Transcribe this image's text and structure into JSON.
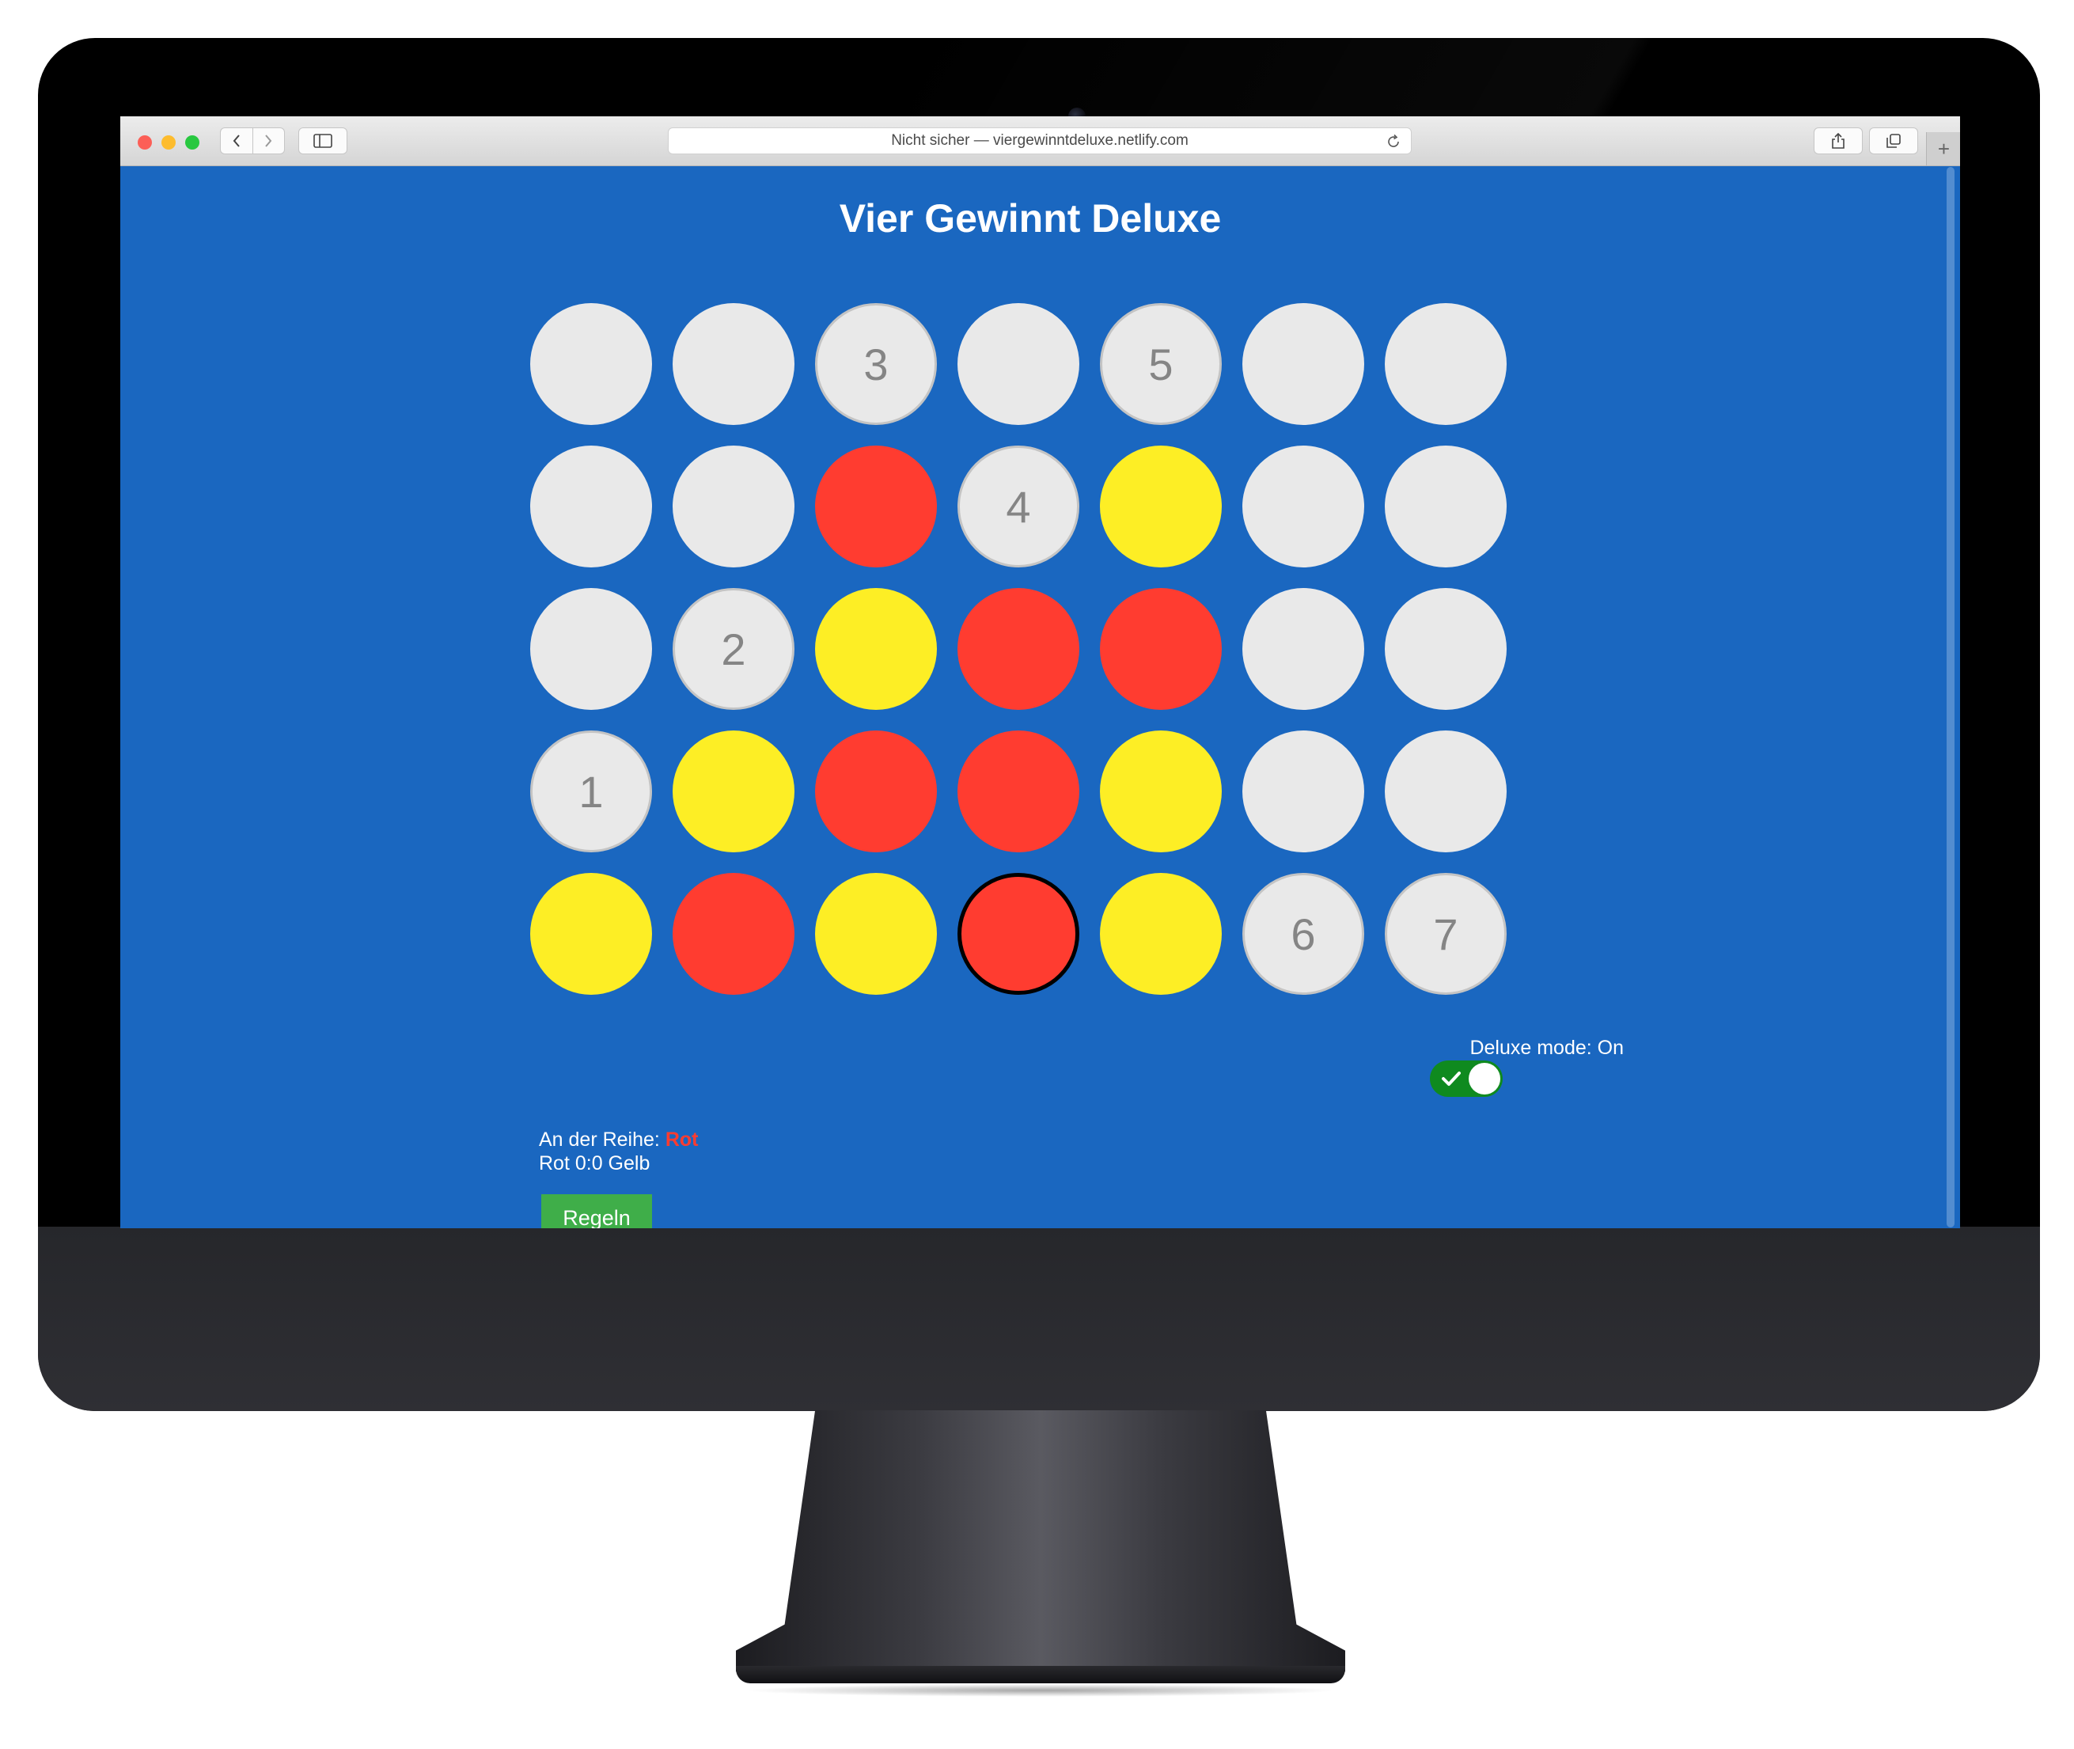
{
  "browser": {
    "address": "Nicht sicher — viergewinntdeluxe.netlify.com"
  },
  "page": {
    "title": "Vier Gewinnt Deluxe"
  },
  "board": {
    "rows": 5,
    "columns": 7,
    "colors": {
      "red": "#ff3c30",
      "yellow": "#fdee25",
      "empty": "#e9e9e9",
      "page_background": "#1a67c0"
    },
    "cells": [
      [
        "empty",
        "empty",
        "hint",
        "empty",
        "hint",
        "empty",
        "empty"
      ],
      [
        "empty",
        "empty",
        "red",
        "hint",
        "yellow",
        "empty",
        "empty"
      ],
      [
        "empty",
        "hint",
        "yellow",
        "red",
        "red",
        "empty",
        "empty"
      ],
      [
        "hint",
        "yellow",
        "red",
        "red",
        "yellow",
        "empty",
        "empty"
      ],
      [
        "yellow",
        "red",
        "yellow",
        "red",
        "yellow",
        "hint",
        "hint"
      ]
    ],
    "hint_labels": [
      [
        "",
        "",
        "3",
        "",
        "5",
        "",
        ""
      ],
      [
        "",
        "",
        "",
        "4",
        "",
        "",
        ""
      ],
      [
        "",
        "2",
        "",
        "",
        "",
        "",
        ""
      ],
      [
        "1",
        "",
        "",
        "",
        "",
        "",
        ""
      ],
      [
        "",
        "",
        "",
        "",
        "",
        "6",
        "7"
      ]
    ],
    "last_move": {
      "row": 5,
      "column": 4
    }
  },
  "deluxe_mode": {
    "label": "Deluxe mode: On",
    "enabled": true
  },
  "status": {
    "turn_prefix": "An der Reihe:",
    "turn_player": "Rot",
    "score": "Rot 0:0 Gelb"
  },
  "buttons": {
    "rules": "Regeln"
  }
}
